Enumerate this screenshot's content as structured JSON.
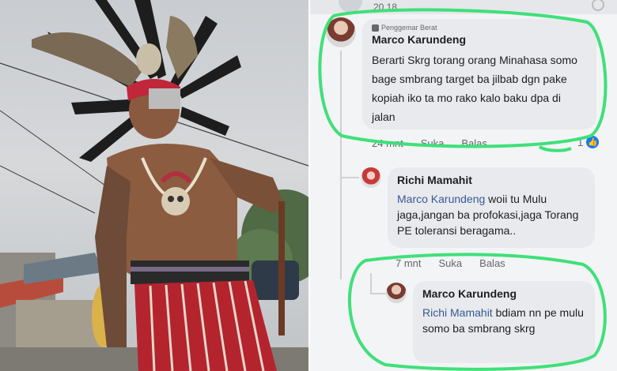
{
  "status_bar": {
    "time": "20.18"
  },
  "comments": [
    {
      "badge": "Penggemar Berat",
      "author": "Marco Karundeng",
      "text": "Berarti Skrg torang orang Minahasa somo bage smbrang target ba jilbab dgn pake kopiah iko ta mo rako kalo baku dpa di jalan",
      "time_ago": "24 mnt",
      "like_label": "Suka",
      "reply_label": "Balas",
      "reaction_count": "1"
    },
    {
      "author": "Richi Mamahit",
      "mention": "Marco Karundeng",
      "text": " woii tu Mulu jaga,jangan ba profokasi,jaga Torang PE toleransi beragama..",
      "time_ago": "7 mnt",
      "like_label": "Suka",
      "reply_label": "Balas"
    },
    {
      "author": "Marco Karundeng",
      "mention": "Richi Mamahit",
      "text": " bdiam nn pe mulu  somo ba smbrang skrg"
    }
  ],
  "colors": {
    "highlight": "#3fe07a",
    "mention": "#385898",
    "bubble": "#e9eaed",
    "like": "#1877f2"
  }
}
